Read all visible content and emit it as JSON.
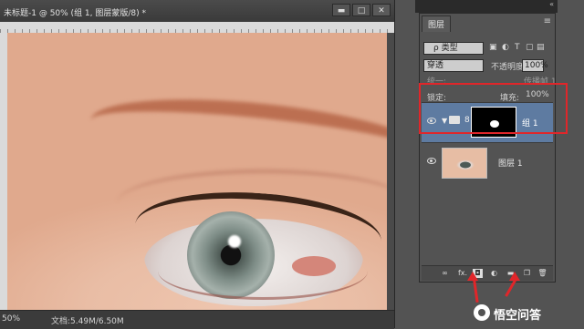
{
  "document": {
    "title": "未标题-1 @ 50% (组 1, 图层蒙版/8) *",
    "window_buttons": {
      "minimize": "▬",
      "restore": "□",
      "close": "✕"
    },
    "status_zoom": "50%",
    "status_doc": "文档:5.49M/6.50M"
  },
  "layers_panel": {
    "tab_label": "图层",
    "filter_label": "ρ 类型",
    "blend_mode": "穿透",
    "opacity_label": "不透明度:",
    "opacity_value": "100%",
    "unify_label": "统一:",
    "propagate_label": "传播帧 1",
    "lock_label": "锁定:",
    "fill_label": "填充:",
    "fill_value": "100%",
    "layers": [
      {
        "name": "组 1",
        "type": "group",
        "selected": true
      },
      {
        "name": "图层 1",
        "type": "image",
        "selected": false
      }
    ],
    "footer_icons": [
      "link-icon",
      "fx-icon",
      "add-mask-icon",
      "adjustment-icon",
      "folder-icon",
      "new-layer-icon",
      "trash-icon"
    ],
    "footer_labels": {
      "link": "∞",
      "fx": "fx.",
      "mask": "◘",
      "adjust": "◐",
      "folder": "▬",
      "new": "❐",
      "trash": "🗑"
    }
  },
  "annotation_color": "#e0262a",
  "selection_color": "#5e7ba1",
  "watermark": {
    "text": "悟空问答"
  }
}
